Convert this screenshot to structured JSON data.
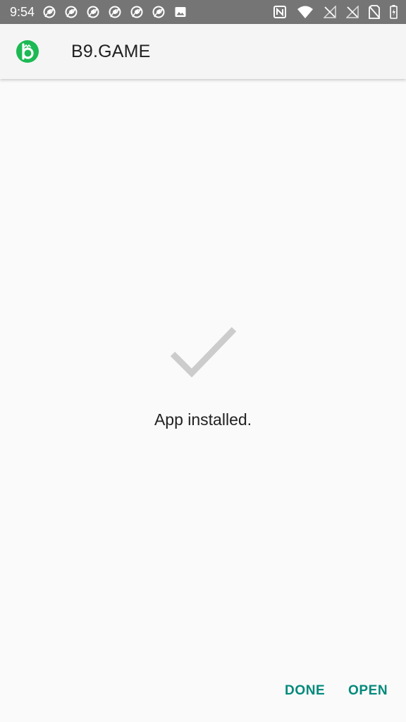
{
  "status_bar": {
    "time": "9:54",
    "notification_icons": [
      "chrome-icon",
      "chrome-icon",
      "chrome-icon",
      "chrome-icon",
      "chrome-icon",
      "chrome-icon",
      "image-icon"
    ],
    "system_icons": [
      "nfc-icon",
      "wifi-icon",
      "signal-off-icon",
      "signal-off-icon",
      "no-sim-icon",
      "battery-icon"
    ]
  },
  "app_bar": {
    "app_name": "B9.GAME",
    "icon_color": "#1db954"
  },
  "content": {
    "status_icon": "checkmark-icon",
    "message": "App installed."
  },
  "actions": {
    "done_label": "DONE",
    "open_label": "OPEN",
    "accent_color": "#00897b"
  }
}
